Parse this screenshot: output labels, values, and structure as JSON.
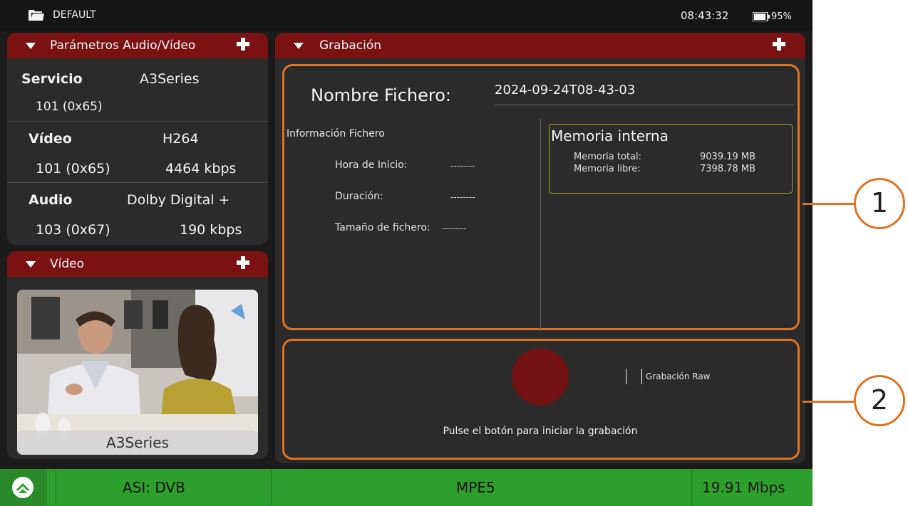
{
  "status_bar": {
    "profile": "DEFAULT",
    "time": "08:43:32",
    "battery": "95%",
    "battery_level": 0.95,
    "icons": [
      "folder-icon",
      "battery-icon"
    ]
  },
  "av_panel": {
    "title": "Parámetros Audio/Vídeo",
    "service_label": "Servicio",
    "service_value": "A3Series",
    "service_pid": "101 (0x65)",
    "video_label": "Vídeo",
    "video_codec": "H264",
    "video_pid": "101 (0x65)",
    "video_rate": "4464 kbps",
    "audio_label": "Audio",
    "audio_codec": "Dolby Digital +",
    "audio_pid": "103 (0x67)",
    "audio_rate": "190 kbps"
  },
  "video_panel": {
    "title": "Vídeo",
    "caption": "A3Series"
  },
  "recording": {
    "title": "Grabación",
    "filename_label": "Nombre Fichero:",
    "filename_value": "2024-09-24T08-43-03",
    "info_title": "Información Fichero",
    "start_label": "Hora de Inicio:",
    "start_value": "--------",
    "duration_label": "Duración:",
    "duration_value": "--------",
    "size_label": "Tamaño de fichero:",
    "size_value": "--------",
    "memory_title": "Memoria interna",
    "mem_total_label": "Memoria total:",
    "mem_total_value": "9039.19 MB",
    "mem_free_label": "Memoria libre:",
    "mem_free_value": "7398.78 MB",
    "raw_label": "Grabación Raw",
    "hint": "Pulse el botón para iniciar la grabación"
  },
  "bottom_bar": {
    "input": "ASI: DVB",
    "program": "MPE5",
    "bitrate": "19.91 Mbps"
  },
  "callouts": [
    "1",
    "2"
  ],
  "colors": {
    "header_red": "#7a1212",
    "record_button": "#731212",
    "accent_orange": "#e07320",
    "bottom_green": "#2d9f2d"
  }
}
